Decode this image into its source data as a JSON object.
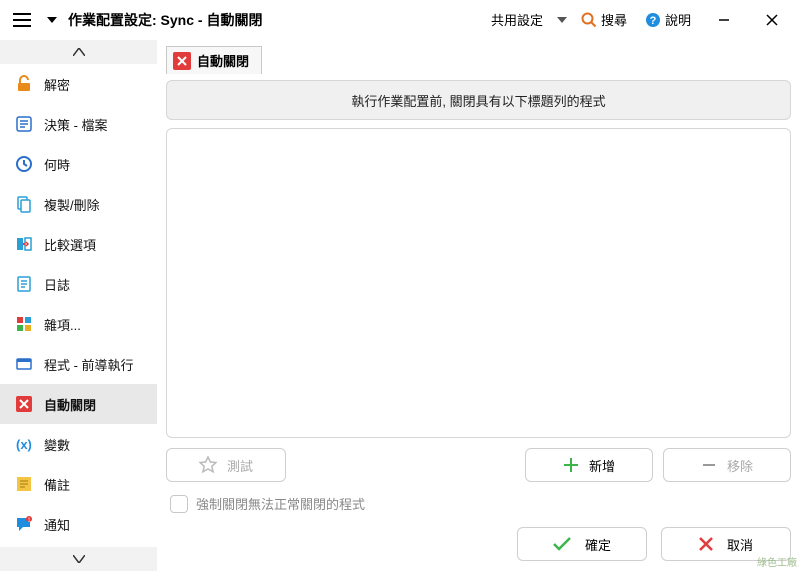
{
  "titlebar": {
    "title": "作業配置設定: Sync - 自動關閉",
    "share_label": "共用設定",
    "search_label": "搜尋",
    "help_label": "說明"
  },
  "sidebar": {
    "items": [
      {
        "label": "解密",
        "icon": "unlock"
      },
      {
        "label": "決策 - 檔案",
        "icon": "decision"
      },
      {
        "label": "何時",
        "icon": "clock"
      },
      {
        "label": "複製/刪除",
        "icon": "copy"
      },
      {
        "label": "比較選項",
        "icon": "compare"
      },
      {
        "label": "日誌",
        "icon": "log"
      },
      {
        "label": "雜項...",
        "icon": "misc"
      },
      {
        "label": "程式 - 前導執行",
        "icon": "program"
      },
      {
        "label": "自動關閉",
        "icon": "close"
      },
      {
        "label": "變數",
        "icon": "vars"
      },
      {
        "label": "備註",
        "icon": "note"
      },
      {
        "label": "通知",
        "icon": "notify"
      }
    ]
  },
  "tab": {
    "label": "自動關閉"
  },
  "info": "執行作業配置前, 關閉具有以下標題列的程式",
  "buttons": {
    "test": "測試",
    "add": "新增",
    "remove": "移除",
    "ok": "確定",
    "cancel": "取消"
  },
  "checkbox": {
    "label": "強制關閉無法正常關閉的程式"
  },
  "watermark": "綠色工廠"
}
